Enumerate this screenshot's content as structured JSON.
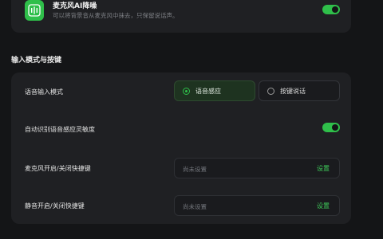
{
  "colors": {
    "accent": "#2fbf4a",
    "background": "#141517",
    "card": "#1f2023"
  },
  "noise_reduction": {
    "icon": "microphone-waveform-icon",
    "title": "麦克风AI降噪",
    "description": "可以将背景音从麦克风中抹去，只保留说话声。",
    "enabled": true
  },
  "input_section": {
    "title": "输入模式与按键",
    "voice_mode": {
      "label": "语音输入模式",
      "options": [
        {
          "label": "语音感应",
          "selected": true
        },
        {
          "label": "按键说话",
          "selected": false
        }
      ]
    },
    "auto_sensitivity": {
      "label": "自动识别语音感应灵敏度",
      "enabled": true
    },
    "mic_hotkey": {
      "label": "麦克风开启/关闭快捷键",
      "placeholder": "尚未设置",
      "action": "设置"
    },
    "mute_hotkey": {
      "label": "静音开启/关闭快捷键",
      "placeholder": "尚未设置",
      "action": "设置"
    }
  }
}
